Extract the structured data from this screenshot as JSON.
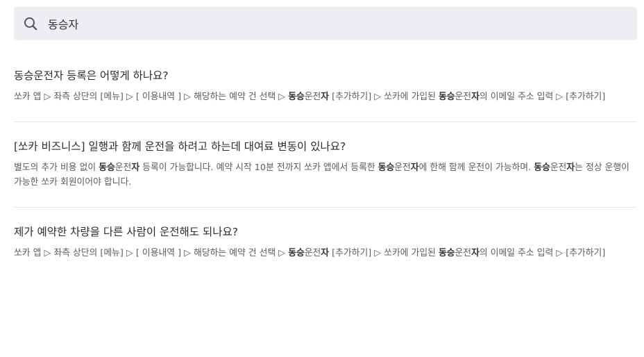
{
  "search": {
    "value": "동승자",
    "placeholder": ""
  },
  "faqs": [
    {
      "question": "동승운전자 등록은 어떻게 하나요?",
      "answer": [
        {
          "t": "쏘카 앱 ▷ 좌측 상단의 [메뉴] ▷ [ 이용내역 ] ▷ 해당하는 예약 건 선택 ▷ ",
          "b": false
        },
        {
          "t": "동승",
          "b": true
        },
        {
          "t": "운전",
          "b": false
        },
        {
          "t": "자",
          "b": true
        },
        {
          "t": " [추가하기] ▷ 쏘카에 가입된 ",
          "b": false
        },
        {
          "t": "동승",
          "b": true
        },
        {
          "t": "운전",
          "b": false
        },
        {
          "t": "자",
          "b": true
        },
        {
          "t": "의 이메일 주소 입력 ▷ [추가하기]",
          "b": false
        }
      ]
    },
    {
      "question": "[쏘카 비즈니스] 일행과 함께 운전을 하려고 하는데 대여료 변동이 있나요?",
      "answer": [
        {
          "t": "별도의 추가 비용 없이 ",
          "b": false
        },
        {
          "t": "동승",
          "b": true
        },
        {
          "t": "운전",
          "b": false
        },
        {
          "t": "자",
          "b": true
        },
        {
          "t": " 등록이 가능합니다. 예약 시작 10분 전까지 쏘카 앱에서 등록한 ",
          "b": false
        },
        {
          "t": "동승",
          "b": true
        },
        {
          "t": "운전",
          "b": false
        },
        {
          "t": "자",
          "b": true
        },
        {
          "t": "에 한해 함께 운전이 가능하며. ",
          "b": false
        },
        {
          "t": "동승",
          "b": true
        },
        {
          "t": "운전",
          "b": false
        },
        {
          "t": "자",
          "b": true
        },
        {
          "t": "는 정상 운행이 가능한 쏘카 회원이어야 합니다.",
          "b": false
        }
      ]
    },
    {
      "question": "제가 예약한 차량을 다른 사람이 운전해도 되나요?",
      "answer": [
        {
          "t": "쏘카 앱 ▷ 좌측 상단의 [메뉴] ▷ [ 이용내역 ] ▷ 해당하는 예약 건 선택 ▷ ",
          "b": false
        },
        {
          "t": "동승",
          "b": true
        },
        {
          "t": "운전",
          "b": false
        },
        {
          "t": "자",
          "b": true
        },
        {
          "t": " [추가하기] ▷ 쏘카에 가입된 ",
          "b": false
        },
        {
          "t": "동승",
          "b": true
        },
        {
          "t": "운전",
          "b": false
        },
        {
          "t": "자",
          "b": true
        },
        {
          "t": "의 이메일 주소 입력 ▷ [추가하기]",
          "b": false
        }
      ]
    }
  ],
  "colors": {
    "search_bg": "#eceef2",
    "divider": "#e6e8eb",
    "question_text": "#2b2b2b",
    "answer_text": "#5a5a5a"
  },
  "icons": {
    "search": "search-icon"
  }
}
